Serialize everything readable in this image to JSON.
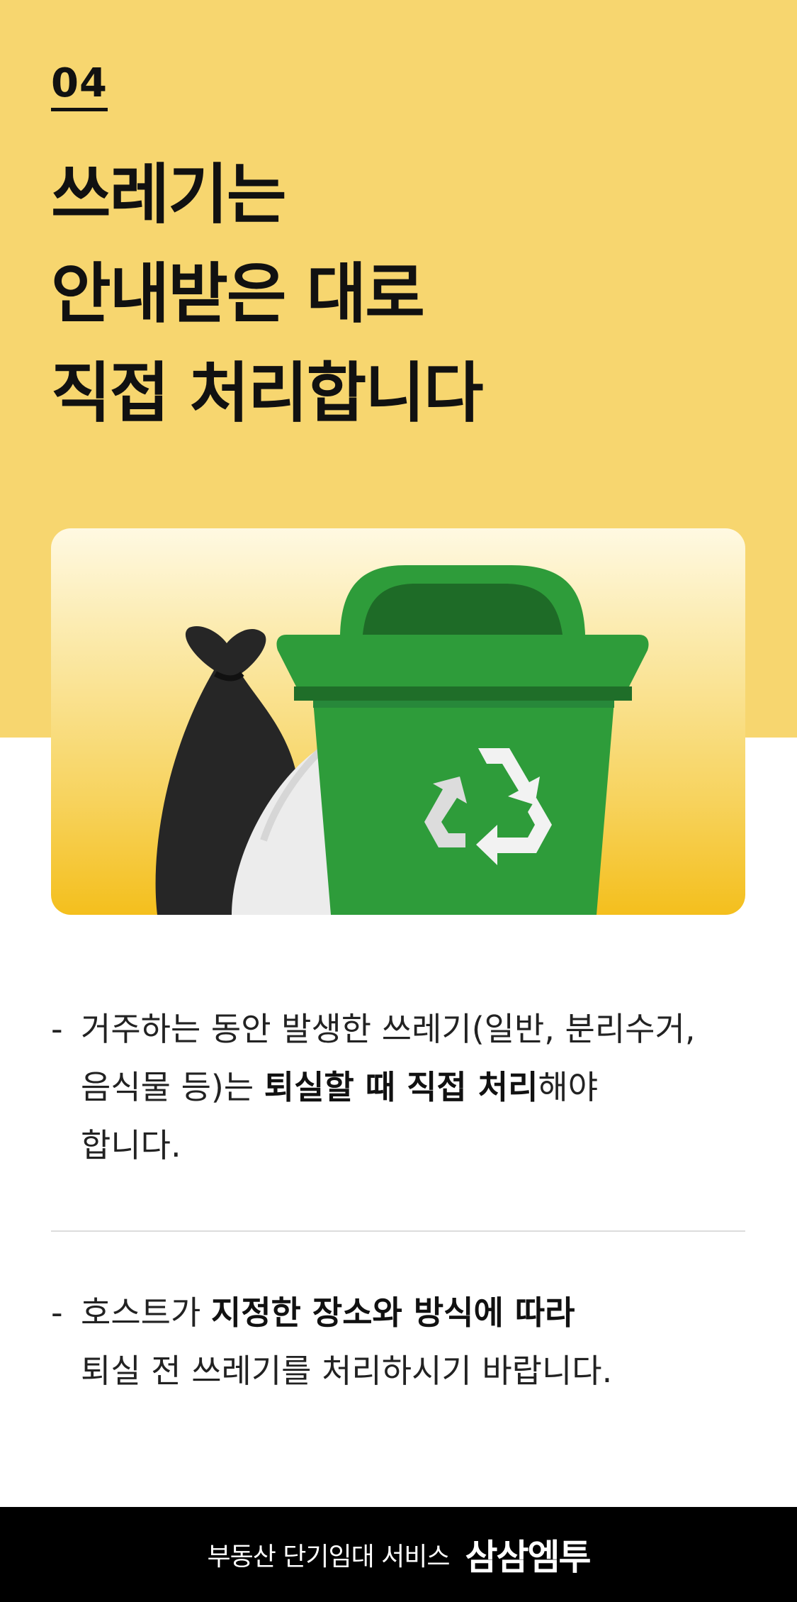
{
  "section": {
    "number": "04",
    "headline_lines": [
      "쓰레기는",
      "안내받은 대로",
      "직접 처리합니다"
    ]
  },
  "illustration": {
    "icons": [
      "black-trash-bag-icon",
      "white-trash-bag-icon",
      "recycle-bin-icon",
      "recycle-symbol-icon"
    ],
    "colors": {
      "band": "#f7d66f",
      "bin": "#2e9c3a",
      "bin_dark": "#1e6b27",
      "bag_black": "#262626",
      "bag_white": "#ececec"
    }
  },
  "bullets": [
    {
      "dash": "-",
      "line1": "거주하는 동안 발생한 쓰레기(일반, 분리수거,",
      "line2_pre": "음식물 등)는 ",
      "line2_bold": "퇴실할 때 직접 처리",
      "line2_post": "해야",
      "line3": "합니다."
    },
    {
      "dash": "-",
      "line1_pre": "호스트가 ",
      "line1_bold": "지정한 장소와 방식에 따라",
      "line2": "퇴실 전 쓰레기를 처리하시기 바랍니다."
    }
  ],
  "footer": {
    "tagline": "부동산 단기임대 서비스",
    "brand": "삼삼엠투"
  }
}
